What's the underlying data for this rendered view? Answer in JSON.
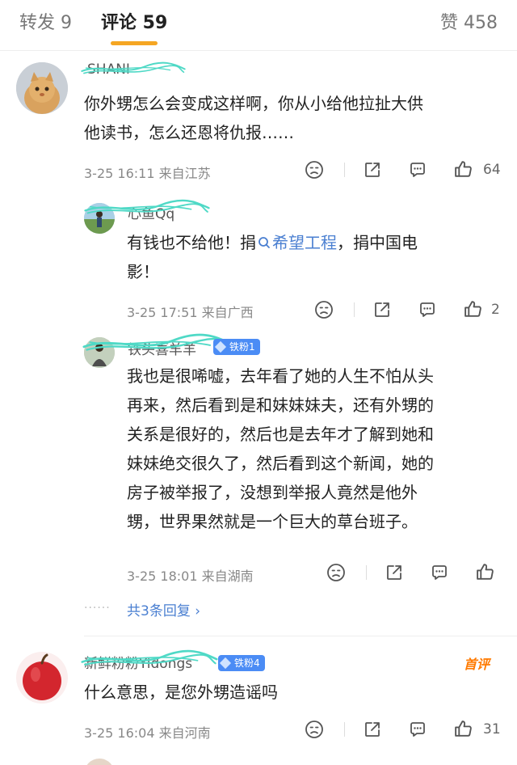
{
  "tabs": {
    "reposts": "转发 9",
    "comments": "评论 59",
    "likes": "赞 458"
  },
  "comments": [
    {
      "user": "SHANI",
      "text_line1": "你外甥怎么会变成这样啊，你从小给他拉扯大供",
      "text_line2": "他读书，怎么还恩将仇报……",
      "meta": "3-25 16:11  来自江苏",
      "like_count": "64"
    },
    {
      "user": "心鱼Qq",
      "text_part1": "有钱也不给他！捐",
      "topic": "希望工程",
      "text_part2": "，捐中国电",
      "text_line2": "影！",
      "meta": "3-25 17:51  来自广西",
      "like_count": "2"
    },
    {
      "user": "铁头喜羊羊",
      "badge": "铁粉1",
      "lines": [
        "我也是很唏嘘，去年看了她的人生不怕从头",
        "再来，然后看到是和妹妹妹夫，还有外甥的",
        "关系是很好的，然后也是去年才了解到她和",
        "妹妹绝交很久了，然后看到这个新闻，她的",
        "房子被举报了，没想到举报人竟然是他外",
        "甥，世界果然就是一个巨大的草台班子。"
      ],
      "meta": "3-25 18:01  来自湖南",
      "like_count": ""
    },
    {
      "more_replies": "共3条回复 ›"
    },
    {
      "user": "新鲜粉粉Yidongs",
      "badge": "铁粉4",
      "first_label": "首评",
      "text_line1": "什么意思，是您外甥造谣吗",
      "meta": "3-25 16:04  来自河南",
      "like_count": "31"
    }
  ],
  "icons": [
    "frown-icon",
    "share-icon",
    "comment-icon",
    "like-icon",
    "search-icon",
    "chevron-right-icon"
  ],
  "colors": {
    "accent_tab": "#f5a623",
    "link": "#4a7fd1",
    "badge": "#4b8cf5",
    "first_label": "#ff7a00",
    "scribble": "#4fd9c6"
  }
}
